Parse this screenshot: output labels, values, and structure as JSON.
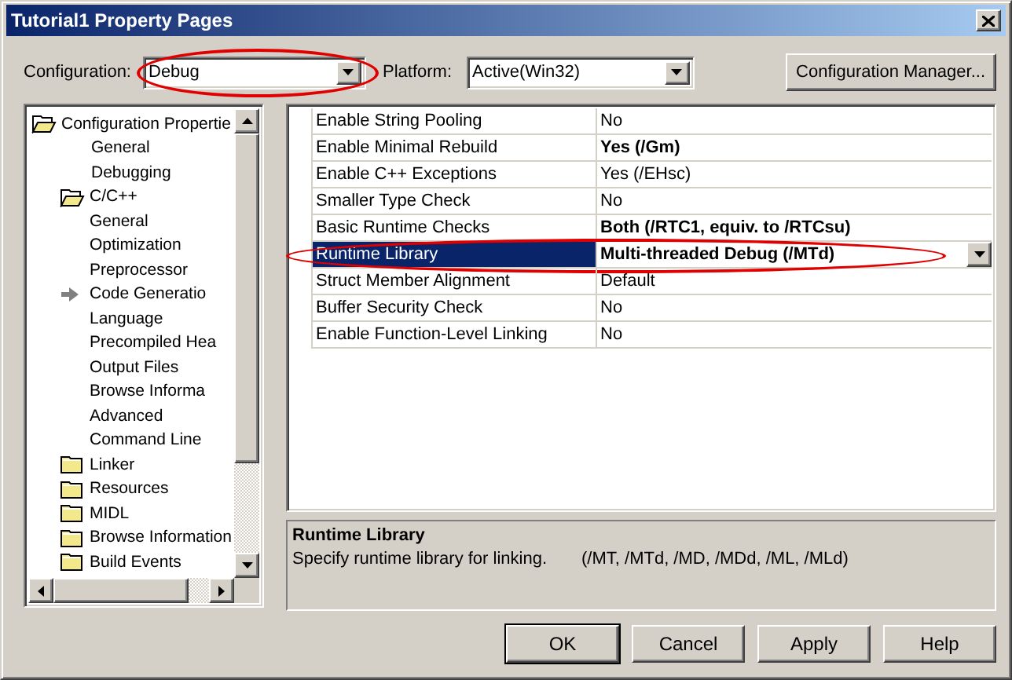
{
  "window": {
    "title": "Tutorial1 Property Pages"
  },
  "configuration": {
    "label": "Configuration:",
    "value": "Debug",
    "highlighted": true
  },
  "platform": {
    "label": "Platform:",
    "value": "Active(Win32)"
  },
  "configuration_manager": {
    "label": "Configuration Manager..."
  },
  "tree": [
    {
      "label": "Configuration Propertie",
      "expanded": true,
      "selected": false,
      "children": [
        {
          "label": "General",
          "selected": false
        },
        {
          "label": "Debugging",
          "selected": false
        },
        {
          "label": "C/C++",
          "expanded": true,
          "selected": false,
          "children": [
            {
              "label": "General",
              "selected": false
            },
            {
              "label": "Optimization",
              "selected": false
            },
            {
              "label": "Preprocessor",
              "selected": false
            },
            {
              "label": "Code Generatio",
              "selected": true
            },
            {
              "label": "Language",
              "selected": false
            },
            {
              "label": "Precompiled Hea",
              "selected": false
            },
            {
              "label": "Output Files",
              "selected": false
            },
            {
              "label": "Browse Informa",
              "selected": false
            },
            {
              "label": "Advanced",
              "selected": false
            },
            {
              "label": "Command Line",
              "selected": false
            }
          ]
        },
        {
          "label": "Linker",
          "expanded": false,
          "selected": false
        },
        {
          "label": "Resources",
          "expanded": false,
          "selected": false
        },
        {
          "label": "MIDL",
          "expanded": false,
          "selected": false
        },
        {
          "label": "Browse Information",
          "expanded": false,
          "selected": false
        },
        {
          "label": "Build Events",
          "expanded": false,
          "selected": false
        }
      ]
    }
  ],
  "properties": [
    {
      "name": "Enable String Pooling",
      "value": "No",
      "bold": false,
      "selected": false
    },
    {
      "name": "Enable Minimal Rebuild",
      "value": "Yes (/Gm)",
      "bold": true,
      "selected": false
    },
    {
      "name": "Enable C++ Exceptions",
      "value": "Yes (/EHsc)",
      "bold": false,
      "selected": false
    },
    {
      "name": "Smaller Type Check",
      "value": "No",
      "bold": false,
      "selected": false
    },
    {
      "name": "Basic Runtime Checks",
      "value": "Both (/RTC1, equiv. to /RTCsu)",
      "bold": true,
      "selected": false
    },
    {
      "name": "Runtime Library",
      "value": "Multi-threaded Debug (/MTd)",
      "bold": true,
      "selected": true,
      "highlighted": true
    },
    {
      "name": "Struct Member Alignment",
      "value": "Default",
      "bold": false,
      "selected": false
    },
    {
      "name": "Buffer Security Check",
      "value": "No",
      "bold": false,
      "selected": false
    },
    {
      "name": "Enable Function-Level Linking",
      "value": "No",
      "bold": false,
      "selected": false
    }
  ],
  "description": {
    "title": "Runtime Library",
    "text": "Specify runtime library for linking.",
    "options": "(/MT, /MTd, /MD, /MDd, /ML, /MLd)"
  },
  "buttons": [
    {
      "label": "OK",
      "default": true
    },
    {
      "label": "Cancel",
      "default": false
    },
    {
      "label": "Apply",
      "default": false
    },
    {
      "label": "Help",
      "default": false
    }
  ]
}
